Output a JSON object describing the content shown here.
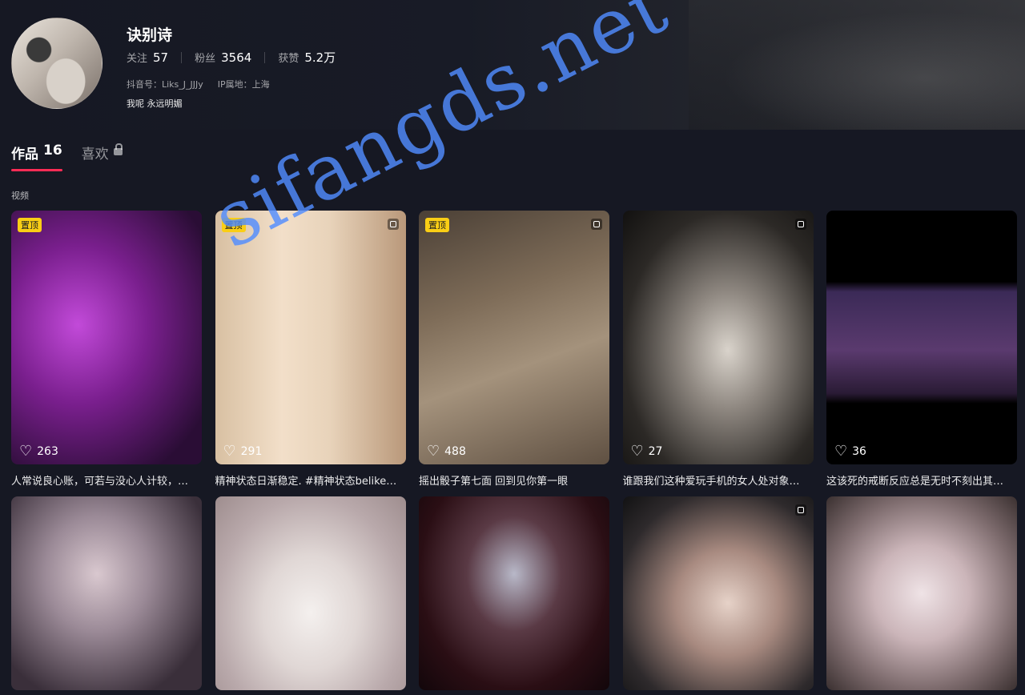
{
  "profile": {
    "name": "诀别诗",
    "following_label": "关注",
    "following_count": "57",
    "followers_label": "粉丝",
    "followers_count": "3564",
    "likes_label": "获赞",
    "likes_count": "5.2万",
    "douyin_id": "抖音号：Liks_J_JJJy",
    "ip_location": "IP属地：上海",
    "signature": "我呢 永远明媚"
  },
  "tabs": {
    "works_label": "作品",
    "works_count": "16",
    "likes_label": "喜欢"
  },
  "section_label": "视频",
  "videos": [
    {
      "pinned": "置顶",
      "likes": "263",
      "caption": "人常说良心账，可若与没心人计较，…",
      "gallery": false
    },
    {
      "pinned": "置顶",
      "likes": "291",
      "caption": "精神状态日渐稳定. #精神状态belike…",
      "gallery": true
    },
    {
      "pinned": "置顶",
      "likes": "488",
      "caption": "摇出骰子第七面 回到见你第一眼",
      "gallery": true
    },
    {
      "pinned": "",
      "likes": "27",
      "caption": "谁跟我们这种爱玩手机的女人处对象…",
      "gallery": true
    },
    {
      "pinned": "",
      "likes": "36",
      "caption": "这该死的戒断反应总是无时不刻出其…",
      "gallery": false
    },
    {
      "gallery": false
    },
    {
      "gallery": false
    },
    {
      "gallery": false
    },
    {
      "gallery": true
    },
    {
      "gallery": false
    }
  ],
  "watermark": "sifangds.net",
  "colors": {
    "accent": "#fe2c55",
    "pinned_badge": "#face15",
    "background": "#161823"
  }
}
